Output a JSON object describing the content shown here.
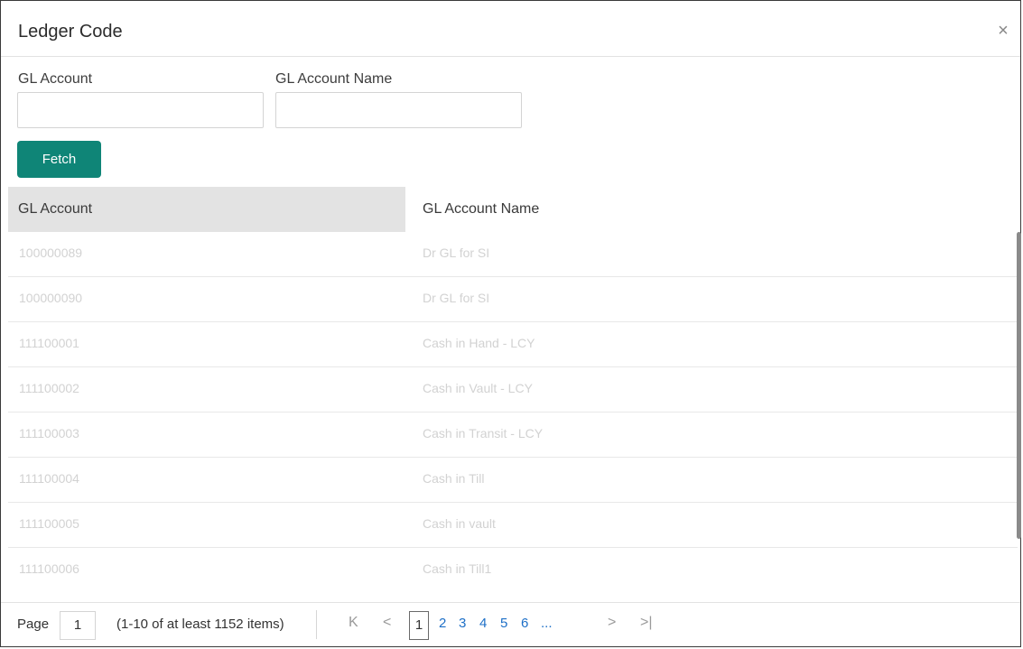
{
  "dialog": {
    "title": "Ledger Code",
    "close_icon": "close-icon",
    "close_glyph": "×"
  },
  "form": {
    "gl_account_label": "GL Account",
    "gl_account_value": "",
    "gl_account_name_label": "GL Account Name",
    "gl_account_name_value": "",
    "fetch_label": "Fetch",
    "fetch_color": "#0f8577"
  },
  "table": {
    "columns": [
      "GL Account",
      "GL Account Name"
    ],
    "rows": [
      [
        "100000089",
        "Dr GL for SI"
      ],
      [
        "100000090",
        "Dr GL for SI"
      ],
      [
        "111100001",
        "Cash in Hand - LCY"
      ],
      [
        "111100002",
        "Cash in Vault - LCY"
      ],
      [
        "111100003",
        "Cash in Transit - LCY"
      ],
      [
        "111100004",
        "Cash in Till"
      ],
      [
        "111100005",
        "Cash in vault"
      ],
      [
        "111100006",
        "Cash in Till1"
      ]
    ]
  },
  "pagination": {
    "page_label": "Page",
    "page_value": "1",
    "summary": "(1-10 of at least 1152 items)",
    "first_glyph": "K",
    "prev_glyph": "<",
    "next_glyph": ">",
    "last_glyph": ">|",
    "current_page": "1",
    "pages": [
      "2",
      "3",
      "4",
      "5",
      "6"
    ],
    "ellipsis": "...",
    "link_color": "#1d6fc7"
  }
}
